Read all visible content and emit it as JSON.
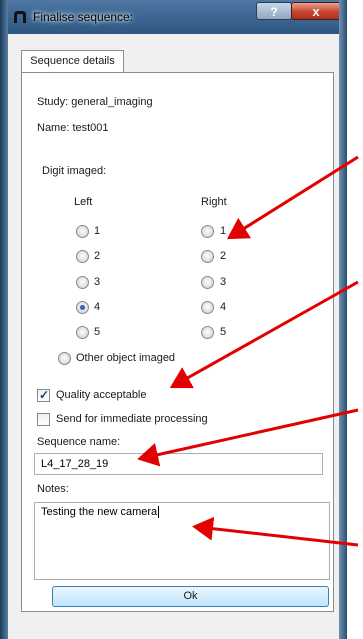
{
  "window": {
    "title": "Finalise sequence:",
    "help_label": "?",
    "close_label": "x"
  },
  "tabs": [
    {
      "label": "Sequence details"
    }
  ],
  "details": {
    "study": "Study: general_imaging",
    "name": "Name: test001"
  },
  "digit": {
    "heading": "Digit imaged:",
    "left_heading": "Left",
    "right_heading": "Right",
    "left_options": [
      {
        "label": "1",
        "checked": false
      },
      {
        "label": "2",
        "checked": false
      },
      {
        "label": "3",
        "checked": false
      },
      {
        "label": "4",
        "checked": true
      },
      {
        "label": "5",
        "checked": false
      }
    ],
    "right_options": [
      {
        "label": "1",
        "checked": false
      },
      {
        "label": "2",
        "checked": false
      },
      {
        "label": "3",
        "checked": false
      },
      {
        "label": "4",
        "checked": false
      },
      {
        "label": "5",
        "checked": false
      }
    ],
    "other_label": "Other object imaged"
  },
  "quality": {
    "label": "Quality acceptable",
    "checked": true
  },
  "send": {
    "label": "Send for immediate processing",
    "checked": false
  },
  "sequence_name": {
    "label": "Sequence name:",
    "value": "L4_17_28_19"
  },
  "notes": {
    "label": "Notes:",
    "value": "Testing the new camera"
  },
  "ok_label": "Ok",
  "colors": {
    "arrow": "#e30000",
    "title_bar": "#2d5680",
    "ok_border": "#3c7fb1"
  }
}
